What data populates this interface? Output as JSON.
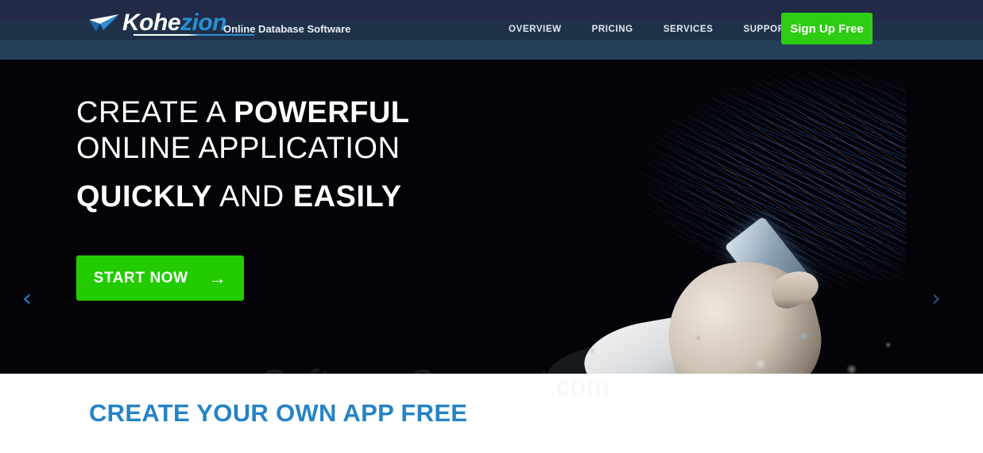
{
  "header": {
    "logo": {
      "mark_icon": "paper-plane-icon",
      "text_primary": "Kohe",
      "text_accent": "zion"
    },
    "tagline": "Online Database Software",
    "nav": [
      {
        "label": "OVERVIEW",
        "has_caret": false
      },
      {
        "label": "PRICING",
        "has_caret": false
      },
      {
        "label": "SERVICES",
        "has_caret": false
      },
      {
        "label": "SUPPORT",
        "has_caret": true
      }
    ],
    "signup_label": "Sign Up Free",
    "colors": {
      "band_top": "#222a47",
      "band_mid": "#1f3149",
      "band_bottom": "#254159",
      "signup_green": "#2ecc12"
    }
  },
  "hero": {
    "headline_line1_normal": "CREATE A ",
    "headline_line1_bold": "POWERFUL",
    "headline_line2": "ONLINE APPLICATION",
    "headline_line3_bold1": "QUICKLY",
    "headline_line3_normal": " AND ",
    "headline_line3_bold2": "EASILY",
    "cta_label": "START NOW",
    "cta_arrow": "→",
    "prev_arrow": "‹",
    "next_arrow": "›",
    "dots": [
      {
        "active": false
      },
      {
        "active": true
      },
      {
        "active": false
      }
    ],
    "background_color": "#030308",
    "cta_color": "#22cc00"
  },
  "watermark": {
    "text_main": "SoftwareSuggest",
    "text_suffix": ".com"
  },
  "below": {
    "title": "CREATE YOUR OWN APP FREE",
    "title_color": "#2683c6"
  }
}
